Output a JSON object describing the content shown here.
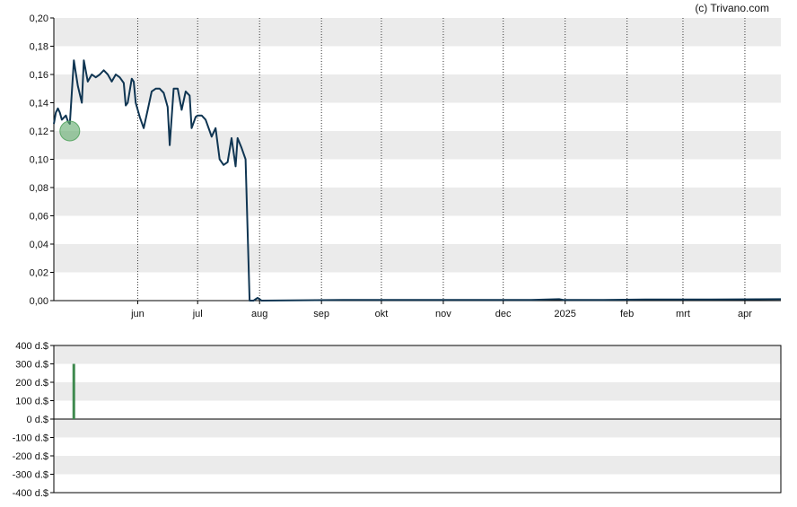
{
  "credit": "(c) Trivano.com",
  "colors": {
    "line": "#0f3552",
    "band": "#ebebeb",
    "marker": "#5faa6a",
    "volume": "#3f8a4f",
    "axis": "#000000"
  },
  "chart_data": [
    {
      "type": "line",
      "title": "",
      "xlabel": "",
      "ylabel": "",
      "ylim": [
        0,
        0.2
      ],
      "y_ticks": [
        "0,00",
        "0,02",
        "0,04",
        "0,06",
        "0,08",
        "0,10",
        "0,12",
        "0,14",
        "0,16",
        "0,18",
        "0,20"
      ],
      "y_tick_values": [
        0,
        0.02,
        0.04,
        0.06,
        0.08,
        0.1,
        0.12,
        0.14,
        0.16,
        0.18,
        0.2
      ],
      "x_range": [
        "2024-04-20",
        "2025-04-19"
      ],
      "x_ticks": [
        {
          "label": "jun",
          "date": "2024-06-01"
        },
        {
          "label": "jul",
          "date": "2024-07-01"
        },
        {
          "label": "aug",
          "date": "2024-08-01"
        },
        {
          "label": "sep",
          "date": "2024-09-01"
        },
        {
          "label": "okt",
          "date": "2024-10-01"
        },
        {
          "label": "nov",
          "date": "2024-11-01"
        },
        {
          "label": "dec",
          "date": "2024-12-01"
        },
        {
          "label": "2025",
          "date": "2025-01-01"
        },
        {
          "label": "feb",
          "date": "2025-02-01"
        },
        {
          "label": "mrt",
          "date": "2025-03-01"
        },
        {
          "label": "apr",
          "date": "2025-04-01"
        }
      ],
      "grid": "vertical dotted lines at month ticks, alternating horizontal bands",
      "highlight": {
        "date": "2024-04-28",
        "value": 0.12
      },
      "series": [
        {
          "points": [
            [
              "2024-04-20",
              0.125
            ],
            [
              "2024-04-21",
              0.133
            ],
            [
              "2024-04-22",
              0.136
            ],
            [
              "2024-04-23",
              0.133
            ],
            [
              "2024-04-24",
              0.128
            ],
            [
              "2024-04-26",
              0.131
            ],
            [
              "2024-04-27",
              0.127
            ],
            [
              "2024-04-28",
              0.125
            ],
            [
              "2024-04-30",
              0.17
            ],
            [
              "2024-05-02",
              0.152
            ],
            [
              "2024-05-04",
              0.14
            ],
            [
              "2024-05-05",
              0.17
            ],
            [
              "2024-05-07",
              0.155
            ],
            [
              "2024-05-09",
              0.16
            ],
            [
              "2024-05-11",
              0.158
            ],
            [
              "2024-05-13",
              0.16
            ],
            [
              "2024-05-15",
              0.163
            ],
            [
              "2024-05-17",
              0.16
            ],
            [
              "2024-05-19",
              0.155
            ],
            [
              "2024-05-21",
              0.16
            ],
            [
              "2024-05-23",
              0.158
            ],
            [
              "2024-05-25",
              0.154
            ],
            [
              "2024-05-26",
              0.138
            ],
            [
              "2024-05-27",
              0.14
            ],
            [
              "2024-05-29",
              0.157
            ],
            [
              "2024-05-30",
              0.155
            ],
            [
              "2024-05-31",
              0.14
            ],
            [
              "2024-06-02",
              0.13
            ],
            [
              "2024-06-04",
              0.122
            ],
            [
              "2024-06-06",
              0.135
            ],
            [
              "2024-06-08",
              0.148
            ],
            [
              "2024-06-10",
              0.15
            ],
            [
              "2024-06-12",
              0.15
            ],
            [
              "2024-06-14",
              0.147
            ],
            [
              "2024-06-16",
              0.137
            ],
            [
              "2024-06-17",
              0.11
            ],
            [
              "2024-06-19",
              0.15
            ],
            [
              "2024-06-21",
              0.15
            ],
            [
              "2024-06-23",
              0.135
            ],
            [
              "2024-06-25",
              0.148
            ],
            [
              "2024-06-27",
              0.145
            ],
            [
              "2024-06-28",
              0.122
            ],
            [
              "2024-06-30",
              0.13
            ],
            [
              "2024-07-01",
              0.131
            ],
            [
              "2024-07-03",
              0.131
            ],
            [
              "2024-07-05",
              0.128
            ],
            [
              "2024-07-07",
              0.12
            ],
            [
              "2024-07-08",
              0.116
            ],
            [
              "2024-07-10",
              0.122
            ],
            [
              "2024-07-12",
              0.1
            ],
            [
              "2024-07-14",
              0.096
            ],
            [
              "2024-07-16",
              0.098
            ],
            [
              "2024-07-18",
              0.115
            ],
            [
              "2024-07-20",
              0.095
            ],
            [
              "2024-07-21",
              0.115
            ],
            [
              "2024-07-23",
              0.108
            ],
            [
              "2024-07-25",
              0.1
            ],
            [
              "2024-07-27",
              0.0
            ],
            [
              "2024-07-29",
              0.0
            ],
            [
              "2024-07-31",
              0.002
            ],
            [
              "2024-08-02",
              0.0
            ],
            [
              "2024-09-15",
              0.0005
            ],
            [
              "2024-10-15",
              0.0005
            ],
            [
              "2024-11-15",
              0.0005
            ],
            [
              "2024-12-15",
              0.0005
            ],
            [
              "2024-12-29",
              0.001
            ],
            [
              "2024-12-31",
              0.0005
            ],
            [
              "2025-01-20",
              0.0005
            ],
            [
              "2025-02-10",
              0.0008
            ],
            [
              "2025-03-15",
              0.0008
            ],
            [
              "2025-04-19",
              0.001
            ]
          ]
        }
      ]
    },
    {
      "type": "bar",
      "title": "",
      "xlabel": "",
      "ylabel": "",
      "ylim": [
        -400,
        400
      ],
      "y_ticks": [
        "400 d.$",
        "300 d.$",
        "200 d.$",
        "100 d.$",
        "0 d.$",
        "-100 d.$",
        "-200 d.$",
        "-300 d.$",
        "-400 d.$"
      ],
      "y_tick_values": [
        400,
        300,
        200,
        100,
        0,
        -100,
        -200,
        -300,
        -400
      ],
      "x_range": [
        "2024-04-20",
        "2025-04-19"
      ],
      "grid": "alternating horizontal bands",
      "series": [
        {
          "bars": [
            [
              "2024-04-30",
              300
            ]
          ]
        }
      ]
    }
  ]
}
